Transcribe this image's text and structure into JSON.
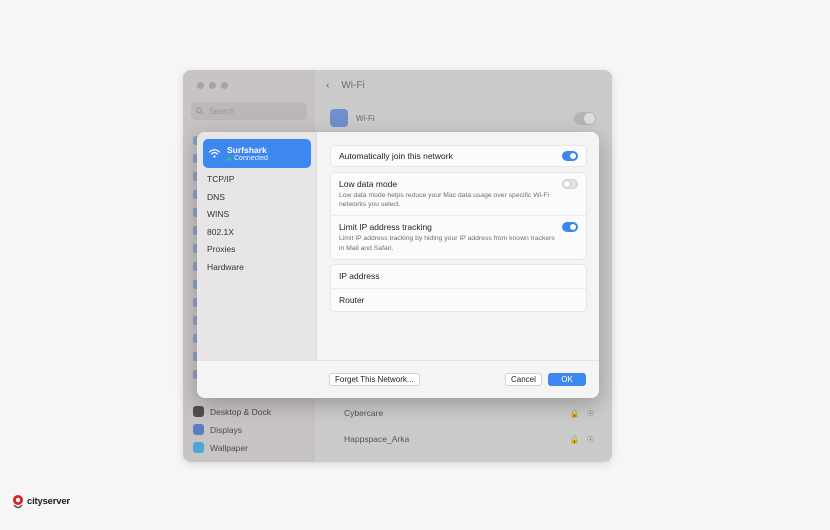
{
  "background_window": {
    "search_placeholder": "Search",
    "title": "Wi-Fi",
    "wifi_label": "Wi-Fi",
    "sidebar_items": [
      {
        "label": "Desktop & Dock",
        "icon": "desktop-dock-icon"
      },
      {
        "label": "Displays",
        "icon": "displays-icon"
      },
      {
        "label": "Wallpaper",
        "icon": "wallpaper-icon"
      }
    ],
    "networks": [
      {
        "name": "Cybercare"
      },
      {
        "name": "Happspace_Arka"
      }
    ]
  },
  "dialog": {
    "network": {
      "name": "Surfshark",
      "status": "Connected"
    },
    "tabs": [
      "TCP/IP",
      "DNS",
      "WINS",
      "802.1X",
      "Proxies",
      "Hardware"
    ],
    "auto_join": {
      "label": "Automatically join this network",
      "enabled": true
    },
    "low_data": {
      "label": "Low data mode",
      "description": "Low data mode helps reduce your Mac data usage over specific Wi-Fi networks you select.",
      "enabled": false
    },
    "limit_ip": {
      "label": "Limit IP address tracking",
      "description": "Limit IP address tracking by hiding your IP address from known trackers in Mail and Safari.",
      "enabled": true
    },
    "info_rows": [
      {
        "label": "IP address",
        "value": ""
      },
      {
        "label": "Router",
        "value": ""
      }
    ],
    "buttons": {
      "forget": "Forget This Network...",
      "cancel": "Cancel",
      "ok": "OK"
    }
  },
  "logo": {
    "text": "cityserver"
  },
  "colors": {
    "accent": "#3d87f1",
    "connected": "#2dcc5a"
  }
}
